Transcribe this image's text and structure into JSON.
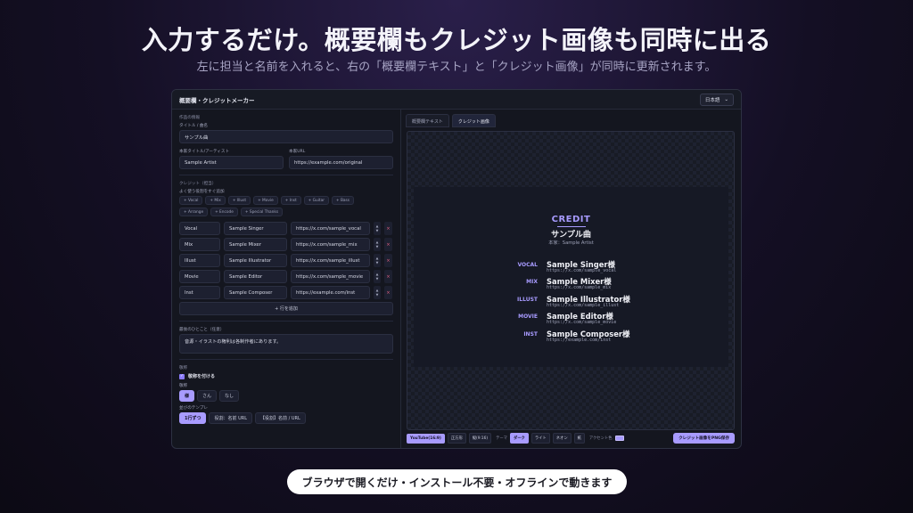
{
  "hero": {
    "title": "入力するだけ。概要欄もクレジット画像も同時に出る",
    "subtitle": "左に担当と名前を入れると、右の「概要欄テキスト」と「クレジット画像」が同時に更新されます。"
  },
  "window": {
    "title": "概要欄・クレジットメーカー",
    "lang": "日本語",
    "lang_icon": "chevron-down-icon"
  },
  "work": {
    "section": "作品の情報",
    "title_label": "タイトル / 曲名",
    "title_value": "サンプル曲",
    "artist_label": "本家タイトル/アーティスト",
    "artist_value": "Sample Artist",
    "url_label": "本家URL",
    "url_value": "https://example.com/original"
  },
  "credits": {
    "section": "クレジット（担当）",
    "hint": "よく使う役割をすぐ追加",
    "chips": [
      "+ Vocal",
      "+ Mix",
      "+ Illust",
      "+ Movie",
      "+ Inst",
      "+ Guitar",
      "+ Bass",
      "+ Arrange",
      "+ Encode",
      "+ Special Thanks"
    ],
    "rows": [
      {
        "role": "Vocal",
        "name": "Sample Singer",
        "url": "https://x.com/sample_vocal"
      },
      {
        "role": "Mix",
        "name": "Sample Mixer",
        "url": "https://x.com/sample_mix"
      },
      {
        "role": "Illust",
        "name": "Sample Illustrator",
        "url": "https://x.com/sample_illust"
      },
      {
        "role": "Movie",
        "name": "Sample Editor",
        "url": "https://x.com/sample_movie"
      },
      {
        "role": "Inst",
        "name": "Sample Composer",
        "url": "https://example.com/inst"
      }
    ],
    "up": "▲",
    "down": "▼",
    "delete": "×",
    "add_row": "+ 行を追加"
  },
  "note": {
    "label": "最後のひとこと（任意）",
    "value": "音源・イラストの権利は各制作者にあります。"
  },
  "honorific": {
    "section": "敬称",
    "checkbox_label": "敬称を付ける",
    "checkmark": "✓",
    "label": "敬称",
    "options": [
      "様",
      "さん",
      "なし"
    ],
    "template_label": "並びのテンプレ",
    "templates": [
      "1行ずつ",
      "役割：名前 URL",
      "【役割】名前 / URL"
    ]
  },
  "tabs": [
    "概要欄テキスト",
    "クレジット画像"
  ],
  "card": {
    "title": "CREDIT",
    "song": "サンプル曲",
    "original": "本家：Sample Artist",
    "entries": [
      {
        "role": "VOCAL",
        "name": "Sample Singer様",
        "url": "https://x.com/sample_vocal"
      },
      {
        "role": "MIX",
        "name": "Sample Mixer様",
        "url": "https://x.com/sample_mix"
      },
      {
        "role": "ILLUST",
        "name": "Sample Illustrator様",
        "url": "https://x.com/sample_illust"
      },
      {
        "role": "MOVIE",
        "name": "Sample Editor様",
        "url": "https://x.com/sample_movie"
      },
      {
        "role": "INST",
        "name": "Sample Composer様",
        "url": "https://example.com/inst"
      }
    ]
  },
  "bottom": {
    "sizes": [
      "YouTube(16:9)",
      "正方形",
      "縦(9:16)"
    ],
    "theme_label": "テーマ",
    "themes": [
      "ダーク",
      "ライト",
      "ネオン",
      "紙"
    ],
    "accent_label": "アクセント色",
    "accent_color": "#a89bff",
    "save": "クレジット画像をPNG保存"
  },
  "footer": "ブラウザで開くだけ・インストール不要・オフラインで動きます"
}
